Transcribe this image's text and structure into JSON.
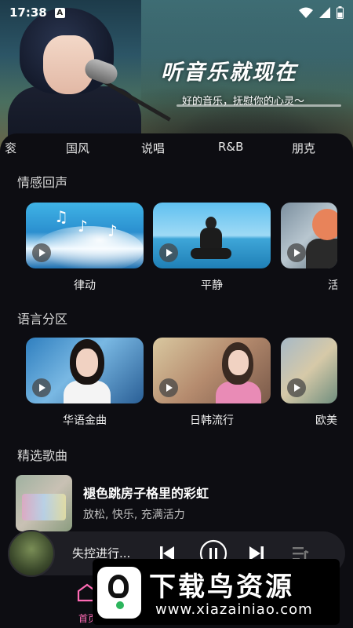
{
  "status_bar": {
    "time": "17:38",
    "notification_badge": "A"
  },
  "hero": {
    "title": "听音乐就现在",
    "subtitle": "好的音乐，抚慰你的心灵～"
  },
  "genres": [
    "衮",
    "国风",
    "说唱",
    "R&B",
    "朋克"
  ],
  "sections": {
    "emotion": {
      "title": "情感回声",
      "cards": [
        {
          "label": "律动",
          "image": "wave-music-notes"
        },
        {
          "label": "平静",
          "image": "meditation-sea"
        },
        {
          "label": "活",
          "image": "city-girl"
        }
      ]
    },
    "language": {
      "title": "语言分区",
      "cards": [
        {
          "label": "华语金曲",
          "image": "girl-portrait"
        },
        {
          "label": "日韩流行",
          "image": "girl-in-car"
        },
        {
          "label": "欧美",
          "image": "street-girl"
        }
      ]
    },
    "featured": {
      "title": "精选歌曲",
      "song": {
        "title": "褪色跳房子格里的彩虹",
        "tags": "放松, 快乐, 充满活力"
      }
    }
  },
  "player": {
    "now_playing": "失控进行..."
  },
  "bottom_nav": {
    "home_label": "首页"
  },
  "watermark": {
    "title": "下载鸟资源",
    "url": "www.xiazainiao.com"
  },
  "colors": {
    "accent": "#ff6bb5",
    "panel": "#0d0d12"
  }
}
